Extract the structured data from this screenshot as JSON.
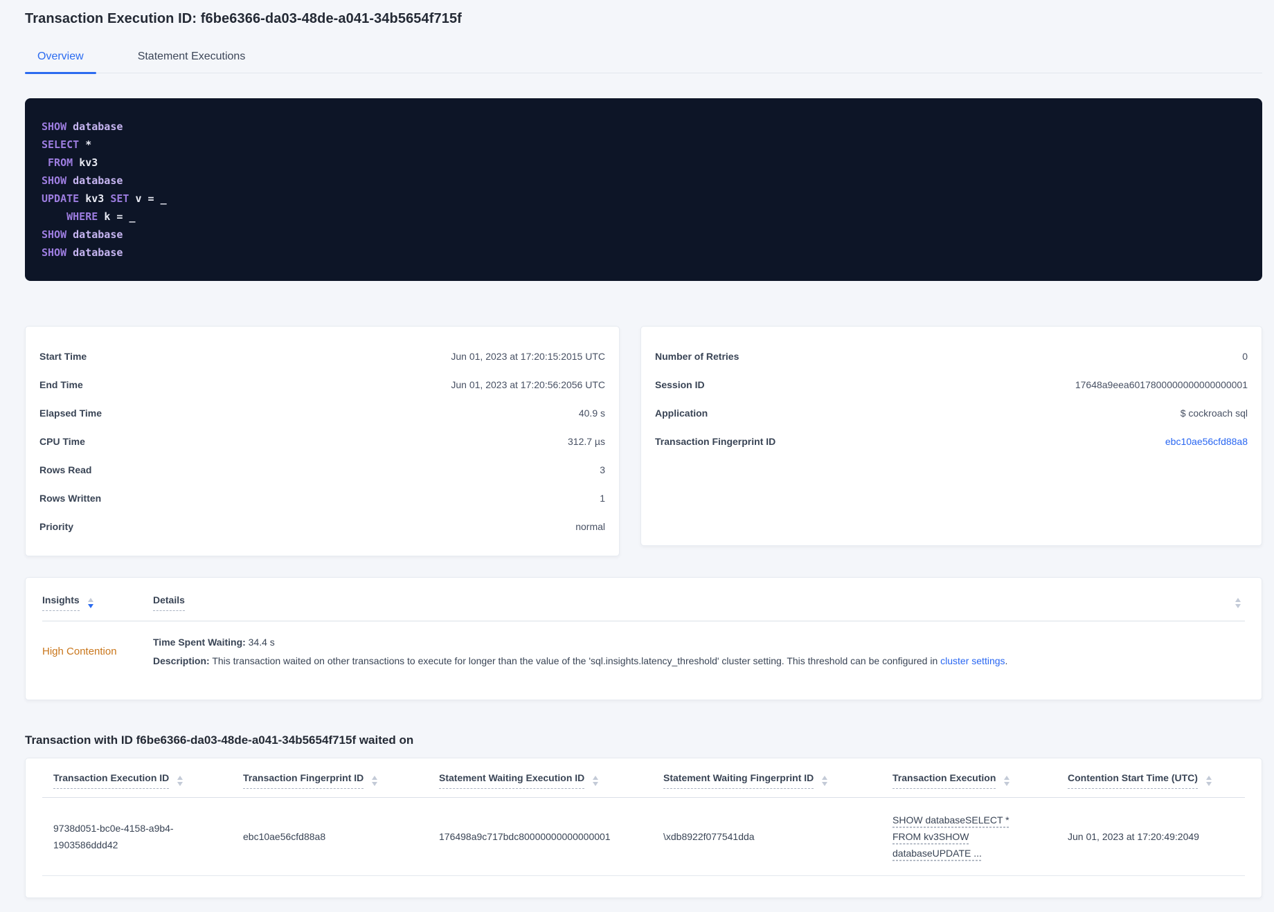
{
  "page": {
    "title": "Transaction Execution ID: f6be6366-da03-48de-a041-34b5654f715f"
  },
  "tabs": [
    {
      "label": "Overview",
      "active": true
    },
    {
      "label": "Statement Executions",
      "active": false
    }
  ],
  "sql": {
    "lines": [
      {
        "tokens": [
          {
            "text": "SHOW ",
            "type": "kw"
          },
          {
            "text": "database",
            "type": "kw2"
          }
        ]
      },
      {
        "tokens": [
          {
            "text": "SELECT ",
            "type": "kw"
          },
          {
            "text": "*",
            "type": "id"
          }
        ]
      },
      {
        "tokens": [
          {
            "text": " ",
            "type": "id"
          },
          {
            "text": "FROM ",
            "type": "kw"
          },
          {
            "text": "kv3",
            "type": "id"
          }
        ]
      },
      {
        "tokens": [
          {
            "text": "SHOW ",
            "type": "kw"
          },
          {
            "text": "database",
            "type": "kw2"
          }
        ]
      },
      {
        "tokens": [
          {
            "text": "UPDATE ",
            "type": "kw"
          },
          {
            "text": "kv3 ",
            "type": "id"
          },
          {
            "text": "SET ",
            "type": "kw"
          },
          {
            "text": "v ",
            "type": "id"
          },
          {
            "text": "= ",
            "type": "id"
          },
          {
            "text": "_",
            "type": "id"
          }
        ]
      },
      {
        "tokens": [
          {
            "text": "    ",
            "type": "id"
          },
          {
            "text": "WHERE ",
            "type": "kw"
          },
          {
            "text": "k ",
            "type": "id"
          },
          {
            "text": "= ",
            "type": "id"
          },
          {
            "text": "_",
            "type": "id"
          }
        ]
      },
      {
        "tokens": [
          {
            "text": "SHOW ",
            "type": "kw"
          },
          {
            "text": "database",
            "type": "kw2"
          }
        ]
      },
      {
        "tokens": [
          {
            "text": "SHOW ",
            "type": "kw"
          },
          {
            "text": "database",
            "type": "kw2"
          }
        ]
      }
    ]
  },
  "summary_left": {
    "rows": [
      {
        "label": "Start Time",
        "value": "Jun 01, 2023 at 17:20:15:2015 UTC"
      },
      {
        "label": "End Time",
        "value": "Jun 01, 2023 at 17:20:56:2056 UTC"
      },
      {
        "label": "Elapsed Time",
        "value": "40.9 s"
      },
      {
        "label": "CPU Time",
        "value": "312.7 µs"
      },
      {
        "label": "Rows Read",
        "value": "3"
      },
      {
        "label": "Rows Written",
        "value": "1"
      },
      {
        "label": "Priority",
        "value": "normal"
      }
    ]
  },
  "summary_right": {
    "rows": [
      {
        "label": "Number of Retries",
        "value": "0"
      },
      {
        "label": "Session ID",
        "value": "17648a9eea6017800000000000000001"
      },
      {
        "label": "Application",
        "value": "$ cockroach sql"
      },
      {
        "label": "Transaction Fingerprint ID",
        "value": "ebc10ae56cfd88a8",
        "link": true
      }
    ]
  },
  "insights": {
    "columns": {
      "insights": "Insights",
      "details": "Details"
    },
    "row": {
      "insight": "High Contention",
      "waiting_label": "Time Spent Waiting:",
      "waiting_value": " 34.4 s",
      "description_label": "Description:",
      "description_text": " This transaction waited on other transactions to execute for longer than the value of the 'sql.insights.latency_threshold' cluster setting. This threshold can be configured in ",
      "description_link": "cluster settings",
      "description_suffix": "."
    }
  },
  "waited_on": {
    "heading": "Transaction with ID f6be6366-da03-48de-a041-34b5654f715f waited on",
    "columns": [
      "Transaction Execution ID",
      "Transaction Fingerprint ID",
      "Statement Waiting Execution ID",
      "Statement Waiting Fingerprint ID",
      "Transaction Execution",
      "Contention Start Time (UTC)"
    ],
    "rows": [
      {
        "transaction_execution_id": "9738d051-bc0e-4158-a9b4-1903586ddd42",
        "transaction_fingerprint_id": "ebc10ae56cfd88a8",
        "statement_waiting_execution_id": "176498a9c717bdc80000000000000001",
        "statement_waiting_fingerprint_id": "\\xdb8922f077541dda",
        "transaction_execution": "SHOW databaseSELECT * FROM kv3SHOW databaseUPDATE ...",
        "contention_start_time": "Jun 01, 2023 at 17:20:49:2049"
      }
    ]
  },
  "colors": {
    "accent": "#2b6bf0",
    "link": "#2866f2",
    "warning": "#c9761b",
    "code_bg": "#0d1527",
    "code_kw": "#9d7de0",
    "code_kw2": "#c6b5f1",
    "code_id": "#e8eaf3"
  }
}
